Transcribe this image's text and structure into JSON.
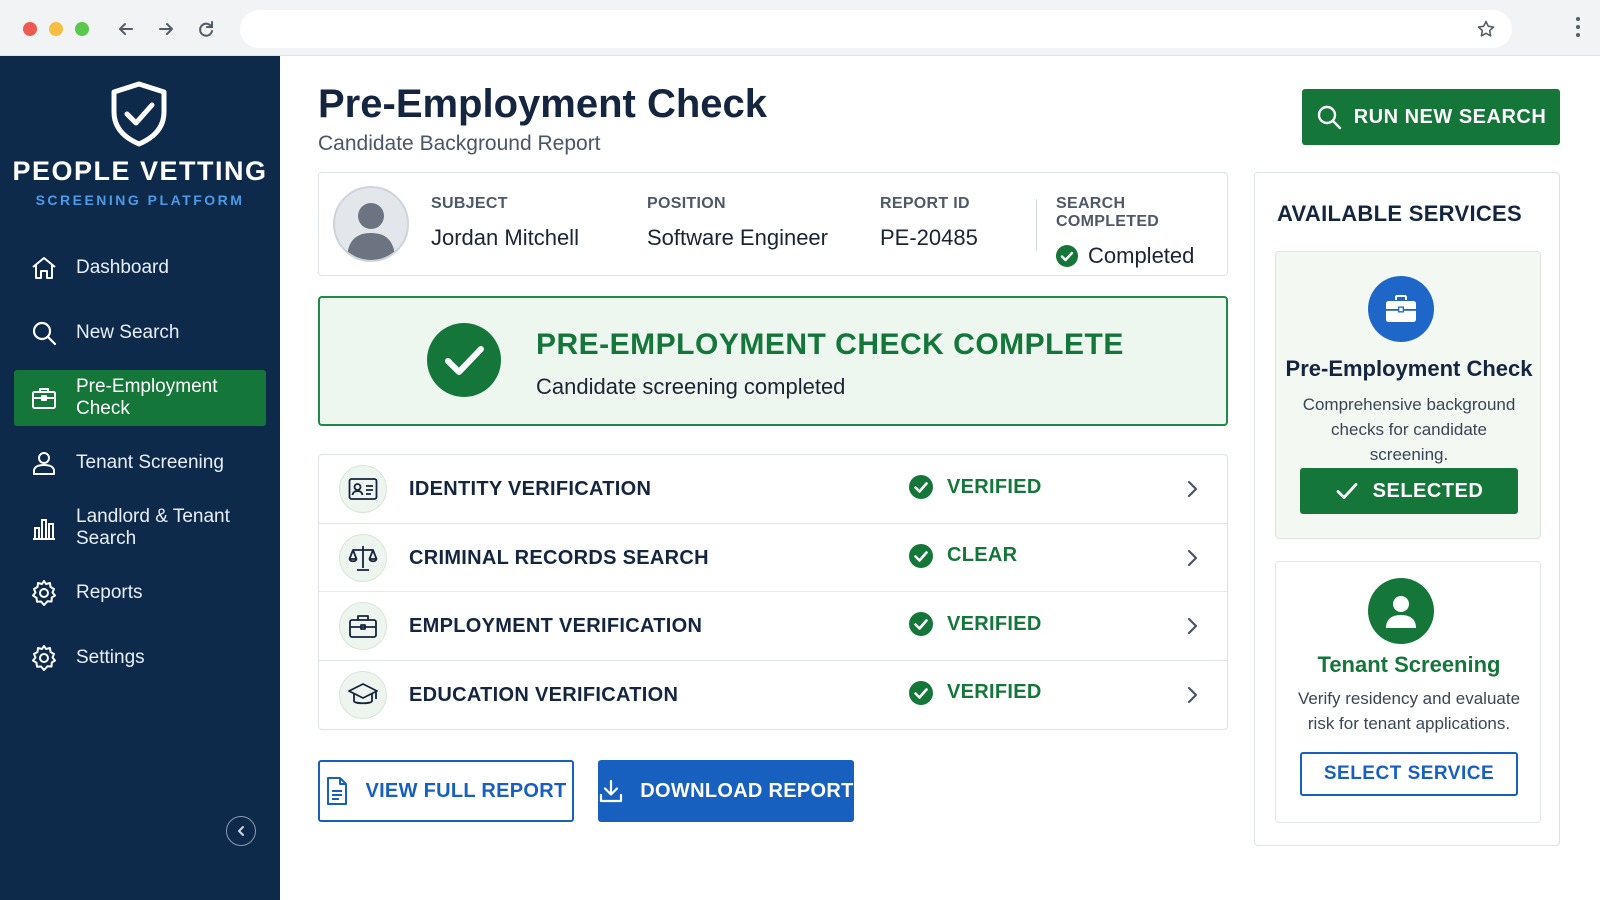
{
  "colors": {
    "brand_navy": "#0e2a4b",
    "accent_green": "#15763a",
    "accent_blue": "#1760c0",
    "brand_sub_blue": "#4d9be8"
  },
  "browser": {
    "icons": [
      "back-icon",
      "forward-icon",
      "reload-icon",
      "star-icon",
      "more-icon"
    ]
  },
  "sidebar": {
    "brand_name": "PEOPLE VETTING",
    "brand_sub": "SCREENING PLATFORM",
    "items": [
      {
        "label": "Dashboard",
        "icon": "home-icon"
      },
      {
        "label": "New Search",
        "icon": "search-icon"
      },
      {
        "label": "Pre-Employment Check",
        "icon": "briefcase-icon",
        "active": true
      },
      {
        "label": "Tenant Screening",
        "icon": "user-icon"
      },
      {
        "label": "Landlord & Tenant Search",
        "icon": "bar-chart-icon"
      },
      {
        "label": "Reports",
        "icon": "gear-icon"
      },
      {
        "label": "Settings",
        "icon": "gear-icon"
      }
    ]
  },
  "header": {
    "title": "Pre-Employment Check",
    "subtitle": "Candidate Background Report",
    "run_button": "RUN NEW SEARCH"
  },
  "subject": {
    "subject_label": "SUBJECT",
    "subject_value": "Jordan Mitchell",
    "position_label": "POSITION",
    "position_value": "Software Engineer",
    "report_label": "REPORT ID",
    "report_value": "PE-20485",
    "status_label": "SEARCH COMPLETED",
    "status_value": "Completed"
  },
  "banner": {
    "title": "PRE-EMPLOYMENT CHECK COMPLETE",
    "subtitle": "Candidate screening completed"
  },
  "checks": [
    {
      "label": "IDENTITY VERIFICATION",
      "status": "VERIFIED",
      "icon": "id-card-icon"
    },
    {
      "label": "CRIMINAL RECORDS SEARCH",
      "status": "CLEAR",
      "icon": "scales-icon"
    },
    {
      "label": "EMPLOYMENT VERIFICATION",
      "status": "VERIFIED",
      "icon": "briefcase-icon"
    },
    {
      "label": "EDUCATION VERIFICATION",
      "status": "VERIFIED",
      "icon": "graduation-cap-icon"
    }
  ],
  "actions": {
    "view_full": "VIEW FULL REPORT",
    "download": "DOWNLOAD REPORT"
  },
  "services": {
    "title": "AVAILABLE SERVICES",
    "items": [
      {
        "name": "Pre-Employment Check",
        "description": "Comprehensive background checks for candidate screening.",
        "button": "SELECTED",
        "selected": true
      },
      {
        "name": "Tenant Screening",
        "description": "Verify residency and evaluate risk for tenant applications.",
        "button": "SELECT SERVICE",
        "selected": false
      }
    ]
  }
}
